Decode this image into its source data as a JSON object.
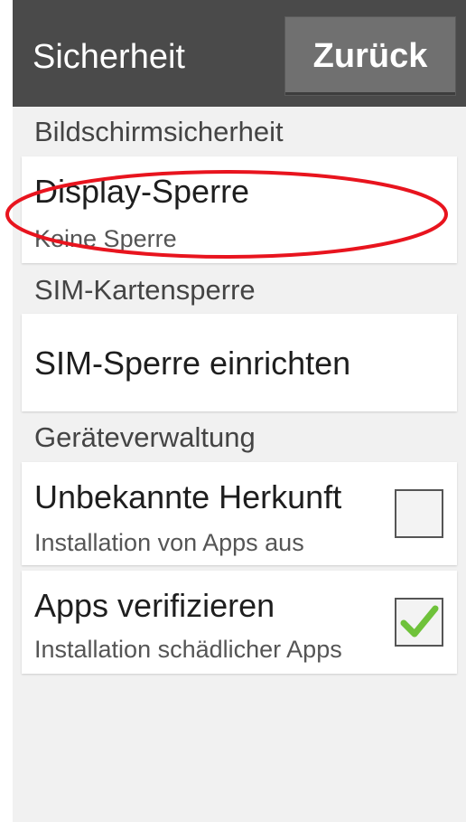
{
  "header": {
    "title": "Sicherheit",
    "back_label": "Zurück"
  },
  "sections": {
    "screen_security": "Bildschirmsicherheit",
    "sim_lock": "SIM-Kartensperre",
    "device_admin": "Geräteverwaltung"
  },
  "display_lock": {
    "title": "Display-Sperre",
    "subtitle": "Keine Sperre"
  },
  "sim_setup": {
    "title": "SIM-Sperre einrichten"
  },
  "unknown_sources": {
    "title": "Unbekannte Herkunft",
    "subtitle": "Installation von Apps aus",
    "checked": false
  },
  "verify_apps": {
    "title": "Apps verifizieren",
    "subtitle": "Installation schädlicher Apps",
    "checked": true
  },
  "colors": {
    "header_bg": "#4a4a4a",
    "button_bg": "#707070",
    "highlight_oval": "#e8141e",
    "check_green": "#6fc23a"
  }
}
